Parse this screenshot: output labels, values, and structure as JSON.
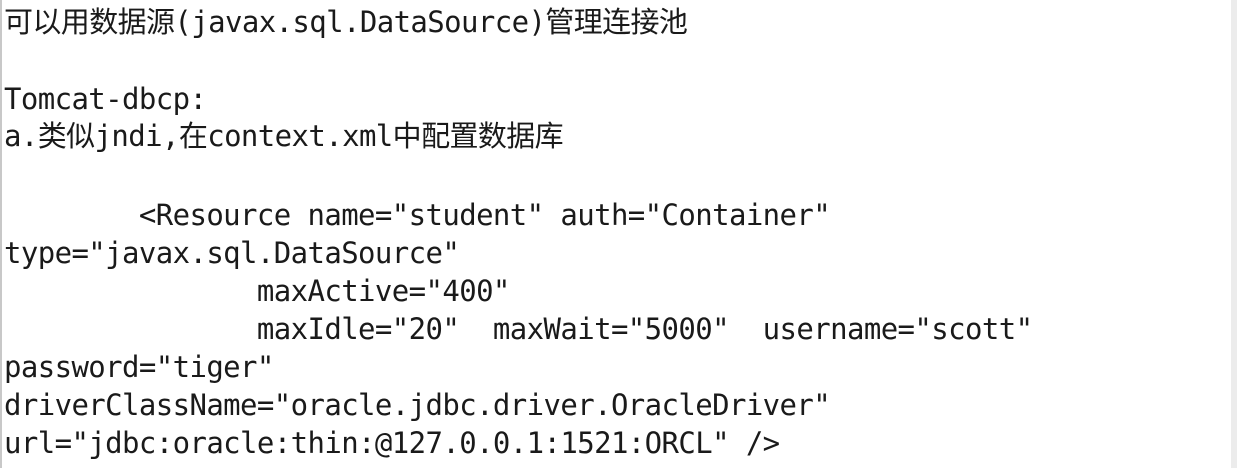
{
  "document": {
    "lines": [
      "可以用数据源(javax.sql.DataSource)管理连接池",
      "Tomcat-dbcp:",
      "a.类似jndi,在context.xml中配置数据库",
      "        <Resource name=\"student\" auth=\"Container\"",
      "type=\"javax.sql.DataSource\"",
      "               maxActive=\"400\"",
      "               maxIdle=\"20\"  maxWait=\"5000\"  username=\"scott\"",
      "password=\"tiger\"",
      "driverClassName=\"oracle.jdbc.driver.OracleDriver\"",
      "url=\"jdbc:oracle:thin:@127.0.0.1:1521:ORCL\" />"
    ]
  }
}
